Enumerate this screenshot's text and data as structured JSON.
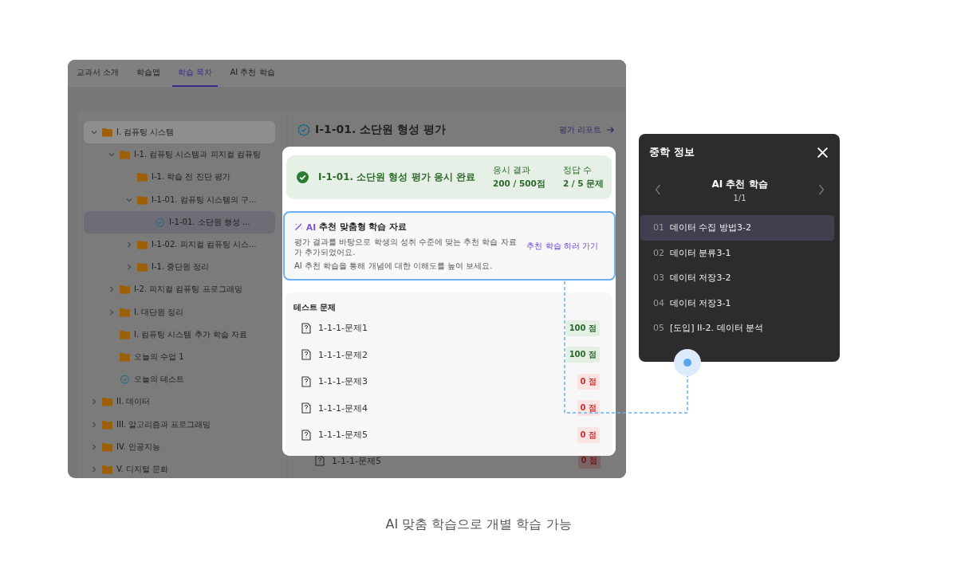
{
  "tabs": [
    {
      "label": "교과서 소개",
      "selected": false
    },
    {
      "label": "학습맵",
      "selected": false
    },
    {
      "label": "학습 목차",
      "selected": true
    },
    {
      "label": "AI 추천 학습",
      "selected": false
    }
  ],
  "tree": [
    {
      "label": "I. 컴퓨팅 시스템",
      "kind": "folder",
      "expanded": true,
      "highlighted": true,
      "selected": false,
      "children": [
        {
          "label": "I-1. 컴퓨팅 시스템과 피지컬 컴퓨팅",
          "kind": "folder",
          "expanded": true,
          "highlighted": false,
          "selected": false,
          "children": [
            {
              "label": "I-1. 학습 전 진단 평가",
              "kind": "folder",
              "highlighted": false,
              "selected": false
            },
            {
              "label": "I-1-01. 컴퓨팅 시스템의 구...",
              "kind": "folder",
              "expanded": true,
              "highlighted": false,
              "selected": false,
              "children": [
                {
                  "label": "I-1-01. 소단원 형성 ...",
                  "kind": "test",
                  "highlighted": false,
                  "selected": true
                }
              ]
            },
            {
              "label": "I-1-02. 피지컬 컴퓨팅 시스...",
              "kind": "folder",
              "expanded": false,
              "highlighted": false,
              "selected": false
            },
            {
              "label": "I-1. 중단원 정리",
              "kind": "folder",
              "expanded": false,
              "highlighted": false,
              "selected": false
            }
          ]
        },
        {
          "label": "I-2. 피지컬 컴퓨팅 프로그래밍",
          "kind": "folder",
          "expanded": false,
          "highlighted": false,
          "selected": false
        },
        {
          "label": "I. 대단원 정리",
          "kind": "folder",
          "expanded": false,
          "highlighted": false,
          "selected": false
        },
        {
          "label": "I. 컴퓨팅 시스템 추가 학습 자료",
          "kind": "folder",
          "highlighted": false,
          "selected": false
        },
        {
          "label": "오늘의 수업 1",
          "kind": "folder",
          "highlighted": false,
          "selected": false
        },
        {
          "label": "오늘의 테스트",
          "kind": "test",
          "highlighted": false,
          "selected": false
        }
      ]
    },
    {
      "label": "II. 데이터",
      "kind": "folder",
      "expanded": false,
      "highlighted": false,
      "selected": false
    },
    {
      "label": "III. 알고리즘과 프로그래밍",
      "kind": "folder",
      "expanded": false,
      "highlighted": false,
      "selected": false
    },
    {
      "label": "IV. 인공지능",
      "kind": "folder",
      "expanded": false,
      "highlighted": false,
      "selected": false
    },
    {
      "label": "V. 디지털 문화",
      "kind": "folder",
      "expanded": false,
      "highlighted": false,
      "selected": false
    }
  ],
  "main": {
    "title": "I-1-01. 소단원 형성 평가",
    "report_link": "평가 리포트",
    "hidden_row": {
      "label": "1-1-1-문제5",
      "score": "0 점",
      "correct": false
    }
  },
  "result_card": {
    "banner": {
      "title": "I-1-01. 소단원 형성 평가 응시 완료",
      "stats": [
        {
          "label": "응시 결과",
          "value": "200 / 500점"
        },
        {
          "label": "정답 수",
          "value": "2 / 5 문제"
        }
      ]
    },
    "ai_box": {
      "ai_label": "AI",
      "title": "추천 맞춤형 학습 자료",
      "description": "평가 결과를 바탕으로 학생의 성취 수준에 맞는 추천 학습 자료가 추가되었어요.",
      "note": "AI 추천 학습을 통해 개념에 대한 이해도를 높여 보세요.",
      "link": "추천 학습 하러 가기"
    },
    "tests": {
      "heading": "테스트 문제",
      "items": [
        {
          "label": "1-1-1-문제1",
          "score": "100 점",
          "correct": true
        },
        {
          "label": "1-1-1-문제2",
          "score": "100 점",
          "correct": true
        },
        {
          "label": "1-1-1-문제3",
          "score": "0 점",
          "correct": false
        },
        {
          "label": "1-1-1-문제4",
          "score": "0 점",
          "correct": false
        },
        {
          "label": "1-1-1-문제5",
          "score": "0 점",
          "correct": false
        }
      ]
    }
  },
  "popup": {
    "title": "중학 정보",
    "section": "AI 추천 학습",
    "page": "1/1",
    "items": [
      {
        "number": "01",
        "label": "데이터 수집 방법3-2",
        "selected": true
      },
      {
        "number": "02",
        "label": "데이터 분류3-1",
        "selected": false
      },
      {
        "number": "03",
        "label": "데이터 저장3-2",
        "selected": false
      },
      {
        "number": "04",
        "label": "데이터 저장3-1",
        "selected": false
      },
      {
        "number": "05",
        "label": "[도입] II-2. 데이터 분석",
        "selected": false
      }
    ]
  },
  "caption": "AI 맞춤 학습으로 개별 학습 가능"
}
